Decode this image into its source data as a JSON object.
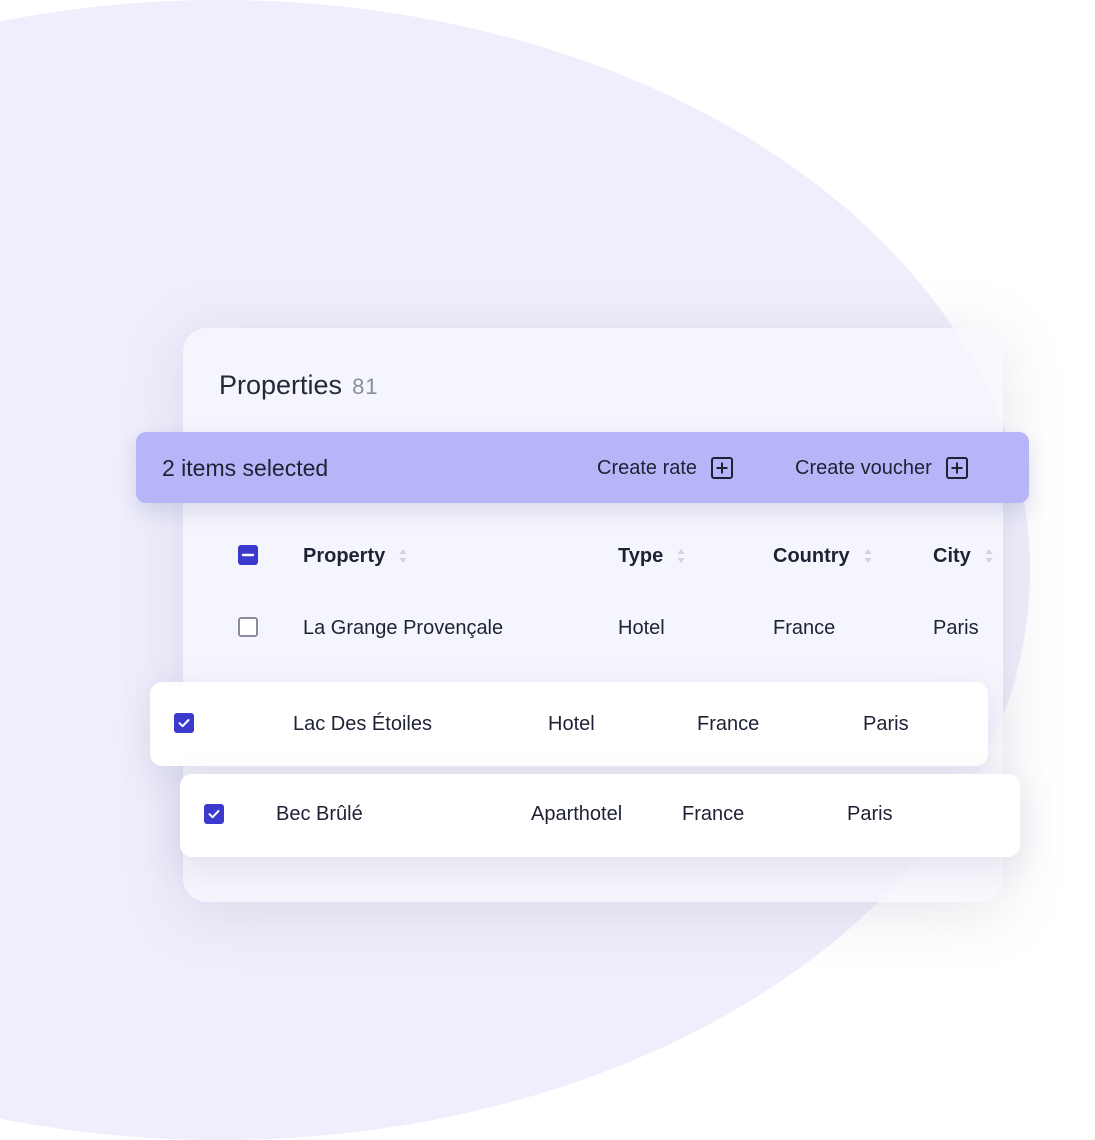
{
  "header": {
    "title": "Properties",
    "count": "81"
  },
  "selection_bar": {
    "text": "2 items selected",
    "actions": [
      {
        "label": "Create rate",
        "icon": "plus-square-icon"
      },
      {
        "label": "Create voucher",
        "icon": "plus-square-icon"
      }
    ]
  },
  "table": {
    "columns": [
      "Property",
      "Type",
      "Country",
      "City"
    ],
    "rows": [
      {
        "checked": false,
        "property": "La Grange Provençale",
        "type": "Hotel",
        "country": "France",
        "city": "Paris"
      },
      {
        "checked": true,
        "property": "Lac Des Étoiles",
        "type": "Hotel",
        "country": "France",
        "city": "Paris"
      },
      {
        "checked": true,
        "property": "Bec Brûlé",
        "type": "Aparthotel",
        "country": "France",
        "city": "Paris"
      }
    ]
  },
  "colors": {
    "accent": "#3c3acc",
    "selection_bar": "#b6b5f7",
    "background_blob": "#eeeefc"
  }
}
